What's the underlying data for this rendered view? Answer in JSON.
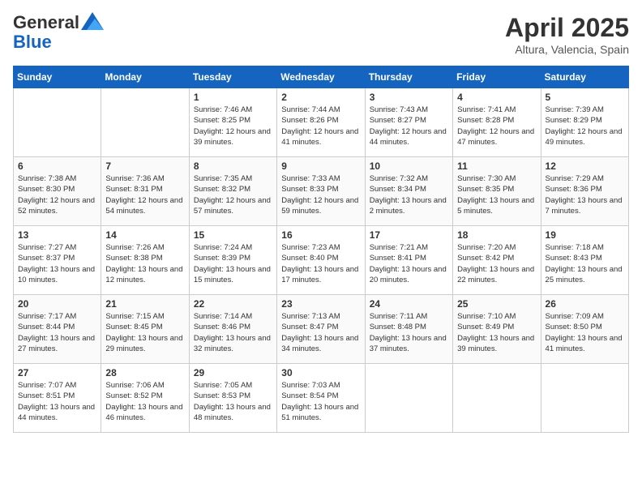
{
  "header": {
    "logo_line1": "General",
    "logo_line2": "Blue",
    "month_title": "April 2025",
    "location": "Altura, Valencia, Spain"
  },
  "weekdays": [
    "Sunday",
    "Monday",
    "Tuesday",
    "Wednesday",
    "Thursday",
    "Friday",
    "Saturday"
  ],
  "weeks": [
    [
      {
        "day": null,
        "sunrise": null,
        "sunset": null,
        "daylight": null
      },
      {
        "day": null,
        "sunrise": null,
        "sunset": null,
        "daylight": null
      },
      {
        "day": "1",
        "sunrise": "Sunrise: 7:46 AM",
        "sunset": "Sunset: 8:25 PM",
        "daylight": "Daylight: 12 hours and 39 minutes."
      },
      {
        "day": "2",
        "sunrise": "Sunrise: 7:44 AM",
        "sunset": "Sunset: 8:26 PM",
        "daylight": "Daylight: 12 hours and 41 minutes."
      },
      {
        "day": "3",
        "sunrise": "Sunrise: 7:43 AM",
        "sunset": "Sunset: 8:27 PM",
        "daylight": "Daylight: 12 hours and 44 minutes."
      },
      {
        "day": "4",
        "sunrise": "Sunrise: 7:41 AM",
        "sunset": "Sunset: 8:28 PM",
        "daylight": "Daylight: 12 hours and 47 minutes."
      },
      {
        "day": "5",
        "sunrise": "Sunrise: 7:39 AM",
        "sunset": "Sunset: 8:29 PM",
        "daylight": "Daylight: 12 hours and 49 minutes."
      }
    ],
    [
      {
        "day": "6",
        "sunrise": "Sunrise: 7:38 AM",
        "sunset": "Sunset: 8:30 PM",
        "daylight": "Daylight: 12 hours and 52 minutes."
      },
      {
        "day": "7",
        "sunrise": "Sunrise: 7:36 AM",
        "sunset": "Sunset: 8:31 PM",
        "daylight": "Daylight: 12 hours and 54 minutes."
      },
      {
        "day": "8",
        "sunrise": "Sunrise: 7:35 AM",
        "sunset": "Sunset: 8:32 PM",
        "daylight": "Daylight: 12 hours and 57 minutes."
      },
      {
        "day": "9",
        "sunrise": "Sunrise: 7:33 AM",
        "sunset": "Sunset: 8:33 PM",
        "daylight": "Daylight: 12 hours and 59 minutes."
      },
      {
        "day": "10",
        "sunrise": "Sunrise: 7:32 AM",
        "sunset": "Sunset: 8:34 PM",
        "daylight": "Daylight: 13 hours and 2 minutes."
      },
      {
        "day": "11",
        "sunrise": "Sunrise: 7:30 AM",
        "sunset": "Sunset: 8:35 PM",
        "daylight": "Daylight: 13 hours and 5 minutes."
      },
      {
        "day": "12",
        "sunrise": "Sunrise: 7:29 AM",
        "sunset": "Sunset: 8:36 PM",
        "daylight": "Daylight: 13 hours and 7 minutes."
      }
    ],
    [
      {
        "day": "13",
        "sunrise": "Sunrise: 7:27 AM",
        "sunset": "Sunset: 8:37 PM",
        "daylight": "Daylight: 13 hours and 10 minutes."
      },
      {
        "day": "14",
        "sunrise": "Sunrise: 7:26 AM",
        "sunset": "Sunset: 8:38 PM",
        "daylight": "Daylight: 13 hours and 12 minutes."
      },
      {
        "day": "15",
        "sunrise": "Sunrise: 7:24 AM",
        "sunset": "Sunset: 8:39 PM",
        "daylight": "Daylight: 13 hours and 15 minutes."
      },
      {
        "day": "16",
        "sunrise": "Sunrise: 7:23 AM",
        "sunset": "Sunset: 8:40 PM",
        "daylight": "Daylight: 13 hours and 17 minutes."
      },
      {
        "day": "17",
        "sunrise": "Sunrise: 7:21 AM",
        "sunset": "Sunset: 8:41 PM",
        "daylight": "Daylight: 13 hours and 20 minutes."
      },
      {
        "day": "18",
        "sunrise": "Sunrise: 7:20 AM",
        "sunset": "Sunset: 8:42 PM",
        "daylight": "Daylight: 13 hours and 22 minutes."
      },
      {
        "day": "19",
        "sunrise": "Sunrise: 7:18 AM",
        "sunset": "Sunset: 8:43 PM",
        "daylight": "Daylight: 13 hours and 25 minutes."
      }
    ],
    [
      {
        "day": "20",
        "sunrise": "Sunrise: 7:17 AM",
        "sunset": "Sunset: 8:44 PM",
        "daylight": "Daylight: 13 hours and 27 minutes."
      },
      {
        "day": "21",
        "sunrise": "Sunrise: 7:15 AM",
        "sunset": "Sunset: 8:45 PM",
        "daylight": "Daylight: 13 hours and 29 minutes."
      },
      {
        "day": "22",
        "sunrise": "Sunrise: 7:14 AM",
        "sunset": "Sunset: 8:46 PM",
        "daylight": "Daylight: 13 hours and 32 minutes."
      },
      {
        "day": "23",
        "sunrise": "Sunrise: 7:13 AM",
        "sunset": "Sunset: 8:47 PM",
        "daylight": "Daylight: 13 hours and 34 minutes."
      },
      {
        "day": "24",
        "sunrise": "Sunrise: 7:11 AM",
        "sunset": "Sunset: 8:48 PM",
        "daylight": "Daylight: 13 hours and 37 minutes."
      },
      {
        "day": "25",
        "sunrise": "Sunrise: 7:10 AM",
        "sunset": "Sunset: 8:49 PM",
        "daylight": "Daylight: 13 hours and 39 minutes."
      },
      {
        "day": "26",
        "sunrise": "Sunrise: 7:09 AM",
        "sunset": "Sunset: 8:50 PM",
        "daylight": "Daylight: 13 hours and 41 minutes."
      }
    ],
    [
      {
        "day": "27",
        "sunrise": "Sunrise: 7:07 AM",
        "sunset": "Sunset: 8:51 PM",
        "daylight": "Daylight: 13 hours and 44 minutes."
      },
      {
        "day": "28",
        "sunrise": "Sunrise: 7:06 AM",
        "sunset": "Sunset: 8:52 PM",
        "daylight": "Daylight: 13 hours and 46 minutes."
      },
      {
        "day": "29",
        "sunrise": "Sunrise: 7:05 AM",
        "sunset": "Sunset: 8:53 PM",
        "daylight": "Daylight: 13 hours and 48 minutes."
      },
      {
        "day": "30",
        "sunrise": "Sunrise: 7:03 AM",
        "sunset": "Sunset: 8:54 PM",
        "daylight": "Daylight: 13 hours and 51 minutes."
      },
      {
        "day": null,
        "sunrise": null,
        "sunset": null,
        "daylight": null
      },
      {
        "day": null,
        "sunrise": null,
        "sunset": null,
        "daylight": null
      },
      {
        "day": null,
        "sunrise": null,
        "sunset": null,
        "daylight": null
      }
    ]
  ]
}
